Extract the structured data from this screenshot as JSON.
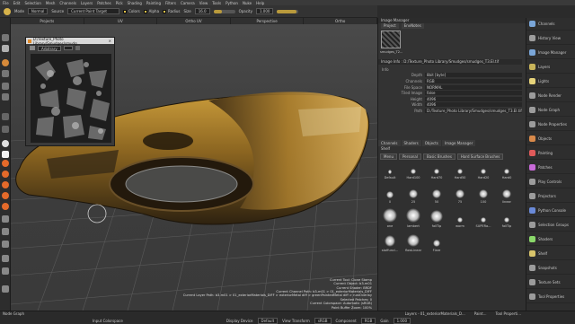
{
  "menubar": {
    "items": [
      "File",
      "Edit",
      "Selection",
      "Mesh",
      "Channels",
      "Layers",
      "Patches",
      "Pick",
      "Shading",
      "Painting",
      "Filters",
      "Camera",
      "View",
      "Tools",
      "Python",
      "Nuke",
      "Help"
    ]
  },
  "toolbar": {
    "mode_label": "Mode",
    "mode_value": "Normal",
    "source_label": "Source",
    "source_value": "Current Paint Target",
    "color_label": "Colors",
    "alpha_label": "Alpha",
    "radius_label": "Radius",
    "size_label": "Size",
    "size_value": "16.0",
    "opacity_label": "Opacity",
    "opacity_value": "1.000",
    "opacity_fraction": 0.9
  },
  "view_tabs": [
    "Projects",
    "UV",
    "Ortho UV",
    "Perspective",
    "Ortho"
  ],
  "floating_window": {
    "title": "D:/Texture_Photo Library/Smudges/smudg...",
    "dropdown": "Arbitrary"
  },
  "image_manager": {
    "title": "Image Manager",
    "tabs": [
      "Project",
      "EnvNotes"
    ],
    "thumb_caption": "smudges_T2...",
    "info_path": "Image Info : D:/Texture_Photo Library/Smudges/smudges_T3.EI.tif",
    "info_section": "Info",
    "rows": [
      {
        "k": "Depth",
        "v": "8bit [byte]"
      },
      {
        "k": "Channels",
        "v": "RGB"
      },
      {
        "k": "File Space",
        "v": "NORMAL"
      },
      {
        "k": "Tiled Image",
        "v": "false"
      },
      {
        "k": "Height",
        "v": "4096"
      },
      {
        "k": "Width",
        "v": "4096"
      },
      {
        "k": "Path",
        "v": "D:/Texture_Photo Library/Smudges/smudges_T3.EI.tif"
      }
    ]
  },
  "shelf": {
    "tabs": [
      "Channels",
      "Shaders",
      "Objects",
      "Image Manager"
    ],
    "title": "Shelf",
    "subtabs": [
      "Menu",
      "Personal",
      "Basic Brushes",
      "Hard Surface Brushes"
    ],
    "brushes": [
      {
        "label": "Default",
        "size": 3
      },
      {
        "label": "Hard100",
        "size": 3.5
      },
      {
        "label": "Hard70",
        "size": 3.5
      },
      {
        "label": "Hard50",
        "size": 3.5
      },
      {
        "label": "Hard20",
        "size": 3.5
      },
      {
        "label": "Hard0",
        "size": 3.5
      },
      {
        "label": "0",
        "size": 5
      },
      {
        "label": "25",
        "size": 6
      },
      {
        "label": "50",
        "size": 6
      },
      {
        "label": "75",
        "size": 6
      },
      {
        "label": "100",
        "size": 6
      },
      {
        "label": "linear",
        "size": 6
      },
      {
        "label": "one",
        "size": 10
      },
      {
        "label": "lambert",
        "size": 10
      },
      {
        "label": "fallTip",
        "size": 9
      },
      {
        "label": "worm",
        "size": 4
      },
      {
        "label": "SUPERa...",
        "size": 4
      },
      {
        "label": "fallTip",
        "size": 4
      },
      {
        "label": "stoffunci...",
        "size": 8
      },
      {
        "label": "flowLinear",
        "size": 9
      },
      {
        "label": "Flare",
        "size": 5
      }
    ]
  },
  "right_panel": {
    "items": [
      {
        "label": "Channels",
        "color": "#7aa6d8"
      },
      {
        "label": "History View",
        "color": "#9c9c9c"
      },
      {
        "label": "Image Manager",
        "color": "#7aa6d8"
      },
      {
        "label": "Layers",
        "color": "#c8b45a"
      },
      {
        "label": "Lights",
        "color": "#e6d37a"
      },
      {
        "label": "Node Render",
        "color": "#9c9c9c"
      },
      {
        "label": "Node Graph",
        "color": "#9c9c9c"
      },
      {
        "label": "Node Properties",
        "color": "#9c9c9c"
      },
      {
        "label": "Objects",
        "color": "#d8894a"
      },
      {
        "label": "Painting",
        "color": "#e05a5a"
      },
      {
        "label": "Patches",
        "color": "#c86ad8"
      },
      {
        "label": "Play Controls",
        "color": "#9c9c9c"
      },
      {
        "label": "Projectors",
        "color": "#9c9c9c"
      },
      {
        "label": "Python Console",
        "color": "#6a8ad8"
      },
      {
        "label": "Selection Groups",
        "color": "#9c9c9c"
      },
      {
        "label": "Shaders",
        "color": "#8ad86a"
      },
      {
        "label": "Shelf",
        "color": "#d8c46a"
      },
      {
        "label": "Snapshots",
        "color": "#9c9c9c"
      },
      {
        "label": "Texture Sets",
        "color": "#9c9c9c"
      },
      {
        "label": "Tool Properties",
        "color": "#9c9c9c"
      }
    ]
  },
  "hud": [
    "Current Tool: Clone Stamp",
    "Current Object: b3-m01",
    "Current Shader: BRDF",
    "Current Channel Path: b3-m01 > 01_exteriorMaterials_DIFF",
    "Current Layer Path: b3-m01 > 01_exteriorMaterials_DIFF > exteriorMetal diff > greenPaintedMetal diff > rustOverlay",
    "Selected Patches: 0",
    "Current Colorspace: Automatic (sRGB)",
    "Paint Buffer Zoom: 100%"
  ],
  "bottom": {
    "node_graph_label": "Node Graph",
    "input_label": "Input Colorspace",
    "display_label": "Display Device",
    "display_value": "Default",
    "view_label": "View Transform",
    "view_value": "sRGB",
    "component_label": "Component",
    "component_value": "RGB",
    "gain_label": "Gain",
    "gain_value": "1.000",
    "right_tabs": [
      "Layers - 01_exteriorMaterials_D...",
      "Paint...",
      "Tool Properti..."
    ]
  }
}
